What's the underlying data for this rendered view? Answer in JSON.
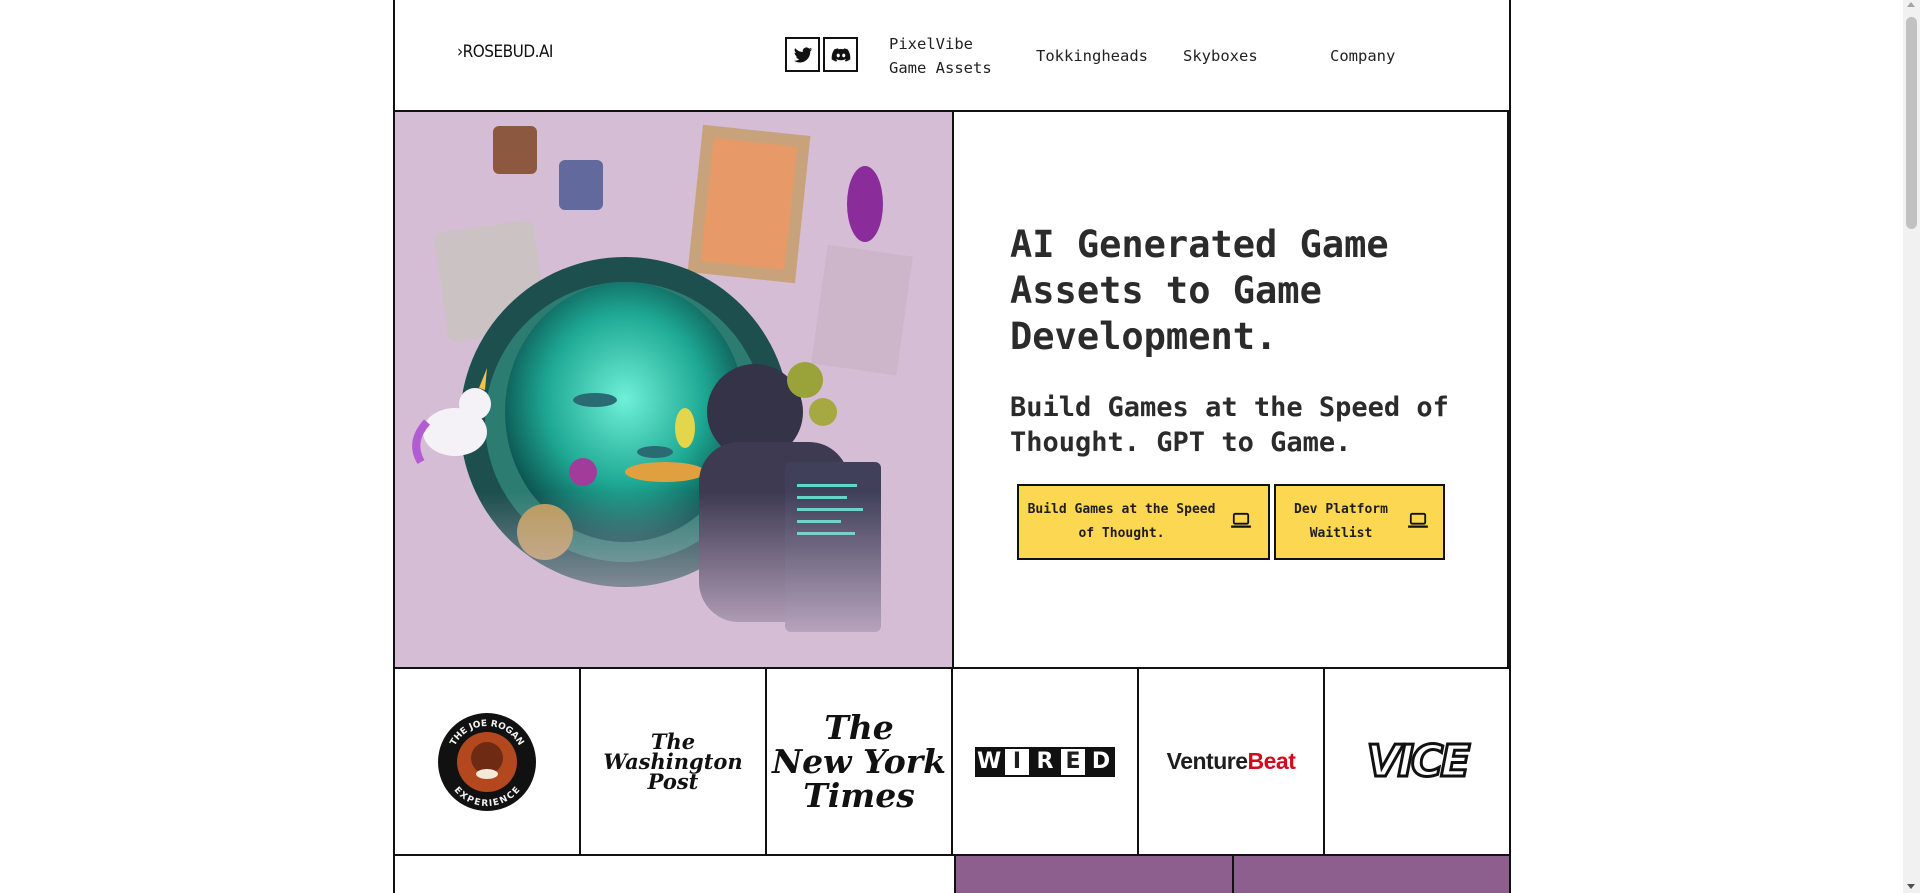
{
  "header": {
    "logo": "›ROSEBUD.AI",
    "social": [
      {
        "name": "twitter-icon"
      },
      {
        "name": "discord-icon"
      }
    ],
    "nav": [
      {
        "line1": "PixelVibe",
        "line2": "Game Assets"
      },
      {
        "line1": "Tokkingheads"
      },
      {
        "line1": "Skyboxes"
      },
      {
        "line1": "Company"
      }
    ]
  },
  "hero": {
    "title": "AI Generated Game Assets to Game Development.",
    "subtitle": "Build Games at the Speed of Thought. GPT to Game.",
    "cta_primary": {
      "line1": "Build Games at the Speed",
      "line2": "of Thought.",
      "icon": "laptop-icon"
    },
    "cta_secondary": {
      "line1": "Dev Platform",
      "line2": "Waitlist",
      "icon": "laptop-icon"
    }
  },
  "press": {
    "joe_rogan": {
      "top": "THE JOE ROGAN",
      "bottom": "EXPERIENCE"
    },
    "wapo": {
      "line1": "The",
      "line2": "Washington",
      "line3": "Post"
    },
    "nyt": {
      "line1": "The",
      "line2": "New York",
      "line3": "Times"
    },
    "wired": [
      "W",
      "I",
      "R",
      "E",
      "D"
    ],
    "venturebeat": {
      "part1": "Venture",
      "part2": "Beat"
    },
    "vice": "VICE"
  },
  "colors": {
    "cta_yellow": "#fcd752",
    "hero_bg": "#d6bdd6",
    "band_purple": "#8c5f8e",
    "venturebeat_red": "#d20b1e"
  }
}
